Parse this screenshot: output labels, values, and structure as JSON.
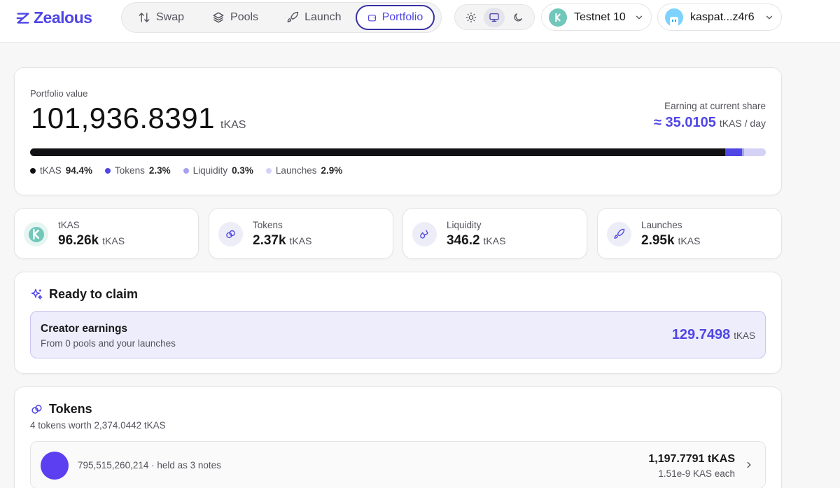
{
  "brand": {
    "name": "Zealous",
    "accent": "#4f46e5"
  },
  "nav": [
    {
      "label": "Swap",
      "icon": "swap-icon",
      "active": false
    },
    {
      "label": "Pools",
      "icon": "layers-icon",
      "active": false
    },
    {
      "label": "Launch",
      "icon": "rocket-icon",
      "active": false
    },
    {
      "label": "Portfolio",
      "icon": "wallet-icon",
      "active": true
    }
  ],
  "theme": {
    "options": [
      "light",
      "system",
      "dark"
    ],
    "selected": "system"
  },
  "network": {
    "label": "Testnet 10",
    "icon": "kaspa-icon"
  },
  "wallet": {
    "label": "kaspat...z4r6"
  },
  "portfolio": {
    "label": "Portfolio value",
    "value": "101,936.8391",
    "unit": "tKAS",
    "earning_label": "Earning at current share",
    "earning_value": "≈ 35.0105",
    "earning_unit": "tKAS / day",
    "allocation": [
      {
        "name": "tKAS",
        "pct": "94.4%",
        "fraction": 0.944,
        "color": "#111113"
      },
      {
        "name": "Tokens",
        "pct": "2.3%",
        "fraction": 0.023,
        "color": "#4f46e5"
      },
      {
        "name": "Liquidity",
        "pct": "0.3%",
        "fraction": 0.003,
        "color": "#a5a0f0"
      },
      {
        "name": "Launches",
        "pct": "2.9%",
        "fraction": 0.029,
        "color": "#d4d1f7"
      }
    ]
  },
  "stats": [
    {
      "label": "tKAS",
      "value": "96.26k",
      "unit": "tKAS",
      "icon": "kaspa-icon"
    },
    {
      "label": "Tokens",
      "value": "2.37k",
      "unit": "tKAS",
      "icon": "coins-icon"
    },
    {
      "label": "Liquidity",
      "value": "346.2",
      "unit": "tKAS",
      "icon": "droplets-icon"
    },
    {
      "label": "Launches",
      "value": "2.95k",
      "unit": "tKAS",
      "icon": "rocket-icon"
    }
  ],
  "claim": {
    "title": "Ready to claim",
    "item_name": "Creator earnings",
    "item_sub": "From 0 pools and your launches",
    "amount": "129.7498",
    "unit": "tKAS"
  },
  "tokens": {
    "title": "Tokens",
    "subtitle": "4 tokens worth 2,374.0442 tKAS",
    "rows": [
      {
        "description": "795,515,260,214 · held as 3 notes",
        "amount": "1,197.7791 tKAS",
        "each": "1.51e-9 KAS each",
        "color": "#5b3ff0"
      }
    ]
  }
}
